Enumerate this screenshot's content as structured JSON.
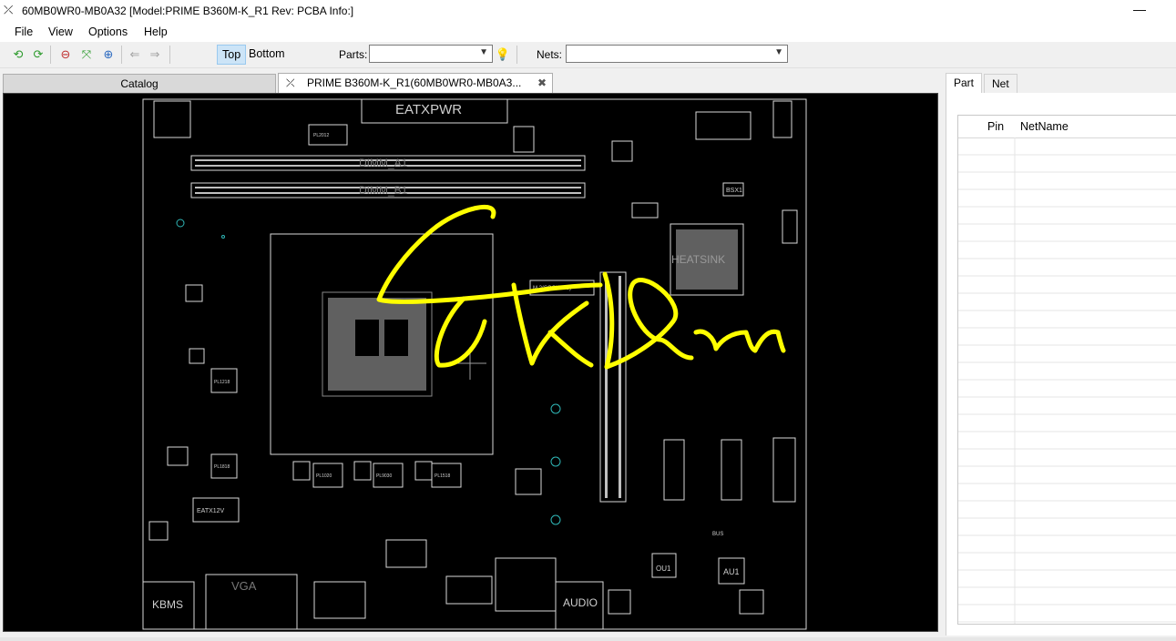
{
  "titlebar": {
    "icon": "⤫",
    "title": "60MB0WR0-MB0A32 [Model:PRIME B360M-K_R1 Rev: PCBA Info:]",
    "minimize": "—"
  },
  "menu": [
    "File",
    "View",
    "Options",
    "Help"
  ],
  "toolbar": {
    "top_label": "Top",
    "bottom_label": "Bottom",
    "parts_label": "Parts:",
    "parts_value": "",
    "nets_label": "Nets:",
    "nets_value": ""
  },
  "tabs": {
    "catalog": "Catalog",
    "board": "PRIME B360M-K_R1(60MB0WR0-MB0A3...",
    "board_icon": "⤫",
    "close": "✖"
  },
  "board_labels": {
    "eatxpwr": "EATXPWR",
    "dimm_a1": "DIMM_A1",
    "dimm_b1": "DIMM_B1",
    "heatsink": "HEATSINK",
    "m2": "M.2(SOCKET3)",
    "pl2012": "PL2012",
    "pl1218": "PL1218",
    "pl1818": "PL1818",
    "pl1020": "PL1020",
    "pl9030": "PL9030",
    "pl1518": "PL1518",
    "eatx12v": "EATX12V",
    "vga": "VGA",
    "kbms": "KBMS",
    "audio": "AUDIO",
    "ou1": "OU1",
    "au1": "AU1",
    "bsx1": "BSX1",
    "bus": "BUS"
  },
  "right_panel": {
    "tab_part": "Part",
    "tab_net": "Net",
    "col_pin": "Pin",
    "col_netname": "NetName"
  },
  "colors": {
    "board_bg": "#000000",
    "outline": "#d8d8d8",
    "signature": "#ffff00",
    "via": "#2fb7b7"
  }
}
